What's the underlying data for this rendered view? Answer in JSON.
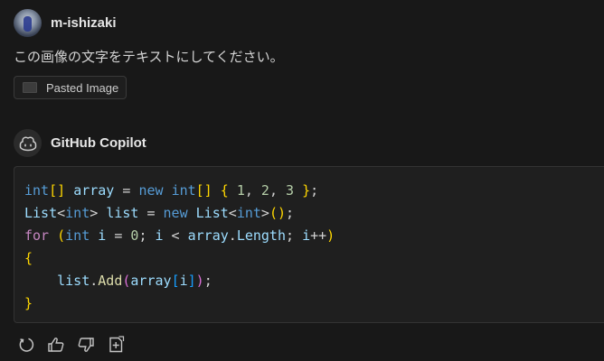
{
  "user": {
    "name": "m-ishizaki",
    "message": "この画像の文字をテキストにしてください。",
    "attachment_label": "Pasted Image"
  },
  "assistant": {
    "name": "GitHub Copilot",
    "code_lines": [
      [
        {
          "t": "int",
          "c": "kw"
        },
        {
          "t": "[]",
          "c": "br1"
        },
        {
          "t": " ",
          "c": "plain"
        },
        {
          "t": "array",
          "c": "var"
        },
        {
          "t": " = ",
          "c": "plain"
        },
        {
          "t": "new",
          "c": "kw"
        },
        {
          "t": " ",
          "c": "plain"
        },
        {
          "t": "int",
          "c": "kw"
        },
        {
          "t": "[]",
          "c": "br1"
        },
        {
          "t": " ",
          "c": "plain"
        },
        {
          "t": "{",
          "c": "br1"
        },
        {
          "t": " ",
          "c": "plain"
        },
        {
          "t": "1",
          "c": "num"
        },
        {
          "t": ", ",
          "c": "plain"
        },
        {
          "t": "2",
          "c": "num"
        },
        {
          "t": ", ",
          "c": "plain"
        },
        {
          "t": "3",
          "c": "num"
        },
        {
          "t": " ",
          "c": "plain"
        },
        {
          "t": "}",
          "c": "br1"
        },
        {
          "t": ";",
          "c": "plain"
        }
      ],
      [
        {
          "t": "List",
          "c": "var"
        },
        {
          "t": "<",
          "c": "plain"
        },
        {
          "t": "int",
          "c": "kw"
        },
        {
          "t": ">",
          "c": "plain"
        },
        {
          "t": " ",
          "c": "plain"
        },
        {
          "t": "list",
          "c": "var"
        },
        {
          "t": " = ",
          "c": "plain"
        },
        {
          "t": "new",
          "c": "kw"
        },
        {
          "t": " ",
          "c": "plain"
        },
        {
          "t": "List",
          "c": "var"
        },
        {
          "t": "<",
          "c": "plain"
        },
        {
          "t": "int",
          "c": "kw"
        },
        {
          "t": ">",
          "c": "plain"
        },
        {
          "t": "()",
          "c": "br1"
        },
        {
          "t": ";",
          "c": "plain"
        }
      ],
      [
        {
          "t": "for",
          "c": "ctl"
        },
        {
          "t": " ",
          "c": "plain"
        },
        {
          "t": "(",
          "c": "br1"
        },
        {
          "t": "int",
          "c": "kw"
        },
        {
          "t": " ",
          "c": "plain"
        },
        {
          "t": "i",
          "c": "var"
        },
        {
          "t": " = ",
          "c": "plain"
        },
        {
          "t": "0",
          "c": "num"
        },
        {
          "t": "; ",
          "c": "plain"
        },
        {
          "t": "i",
          "c": "var"
        },
        {
          "t": " < ",
          "c": "plain"
        },
        {
          "t": "array",
          "c": "var"
        },
        {
          "t": ".",
          "c": "plain"
        },
        {
          "t": "Length",
          "c": "var"
        },
        {
          "t": "; ",
          "c": "plain"
        },
        {
          "t": "i",
          "c": "var"
        },
        {
          "t": "++",
          "c": "plain"
        },
        {
          "t": ")",
          "c": "br1"
        }
      ],
      [
        {
          "t": "{",
          "c": "br1"
        }
      ],
      [
        {
          "t": "    ",
          "c": "plain"
        },
        {
          "t": "list",
          "c": "var"
        },
        {
          "t": ".",
          "c": "plain"
        },
        {
          "t": "Add",
          "c": "fn"
        },
        {
          "t": "(",
          "c": "br2"
        },
        {
          "t": "array",
          "c": "var"
        },
        {
          "t": "[",
          "c": "br3"
        },
        {
          "t": "i",
          "c": "var"
        },
        {
          "t": "]",
          "c": "br3"
        },
        {
          "t": ")",
          "c": "br2"
        },
        {
          "t": ";",
          "c": "plain"
        }
      ],
      [
        {
          "t": "}",
          "c": "br1"
        }
      ]
    ],
    "actions": [
      "retry-icon",
      "thumbs-up-icon",
      "thumbs-down-icon",
      "insert-into-new-file-icon"
    ]
  },
  "colors": {
    "background": "#181818",
    "code_background": "#1f1f1f",
    "keyword": "#569cd6",
    "variable": "#9cdcfe",
    "number": "#b5cea8",
    "bracket": "#ffd700",
    "control": "#c586c0",
    "function": "#dcdcaa"
  }
}
